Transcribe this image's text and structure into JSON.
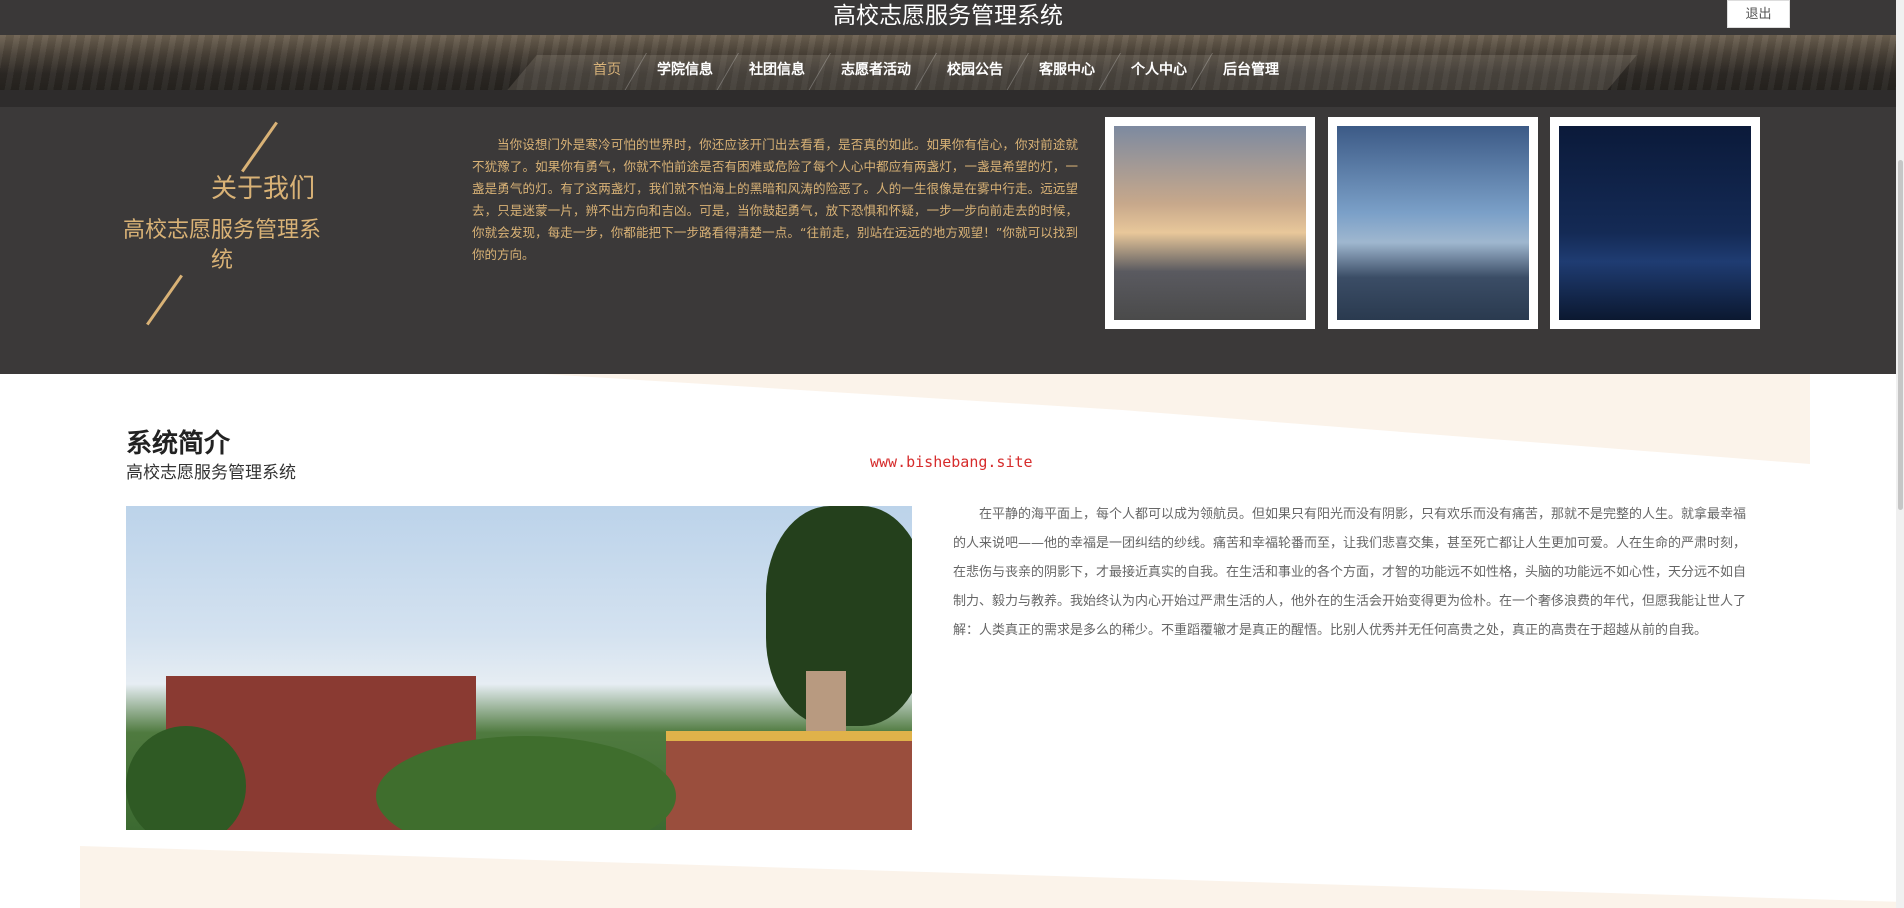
{
  "header": {
    "site_title": "高校志愿服务管理系统",
    "logout_label": "退出"
  },
  "nav": {
    "items": [
      {
        "label": "首页",
        "active": true
      },
      {
        "label": "学院信息"
      },
      {
        "label": "社团信息"
      },
      {
        "label": "志愿者活动"
      },
      {
        "label": "校园公告"
      },
      {
        "label": "客服中心"
      },
      {
        "label": "个人中心"
      },
      {
        "label": "后台管理"
      }
    ]
  },
  "about": {
    "title": "关于我们",
    "subtitle": "高校志愿服务管理系统",
    "text": "当你设想门外是寒冷可怕的世界时，你还应该开门出去看看，是否真的如此。如果你有信心，你对前途就不犹豫了。如果你有勇气，你就不怕前途是否有困难或危险了每个人心中都应有两盏灯，一盏是希望的灯，一盏是勇气的灯。有了这两盏灯，我们就不怕海上的黑暗和风涛的险恶了。人的一生很像是在雾中行走。远远望去，只是迷蒙一片，辨不出方向和吉凶。可是，当你鼓起勇气，放下恐惧和怀疑，一步一步向前走去的时候，你就会发现，每走一步，你都能把下一步路看得清楚一点。“往前走，别站在远远的地方观望！”你就可以找到你的方向。",
    "colors": {
      "accent": "#d9b276",
      "background": "#3b3939"
    }
  },
  "intro": {
    "title": "系统简介",
    "subtitle": "高校志愿服务管理系统",
    "watermark": "www.bishebang.site",
    "text": "在平静的海平面上，每个人都可以成为领航员。但如果只有阳光而没有阴影，只有欢乐而没有痛苦，那就不是完整的人生。就拿最幸福的人来说吧——他的幸福是一团纠结的纱线。痛苦和幸福轮番而至，让我们悲喜交集，甚至死亡都让人生更加可爱。人在生命的严肃时刻，在悲伤与丧亲的阴影下，才最接近真实的自我。在生活和事业的各个方面，才智的功能远不如性格，头脑的功能远不如心性，天分远不如自制力、毅力与教养。我始终认为内心开始过严肃生活的人，他外在的生活会开始变得更为俭朴。在一个奢侈浪费的年代，但愿我能让世人了解：人类真正的需求是多么的稀少。不重蹈覆辙才是真正的醒悟。比别人优秀并无任何高贵之处，真正的高贵在于超越从前的自我。"
  }
}
